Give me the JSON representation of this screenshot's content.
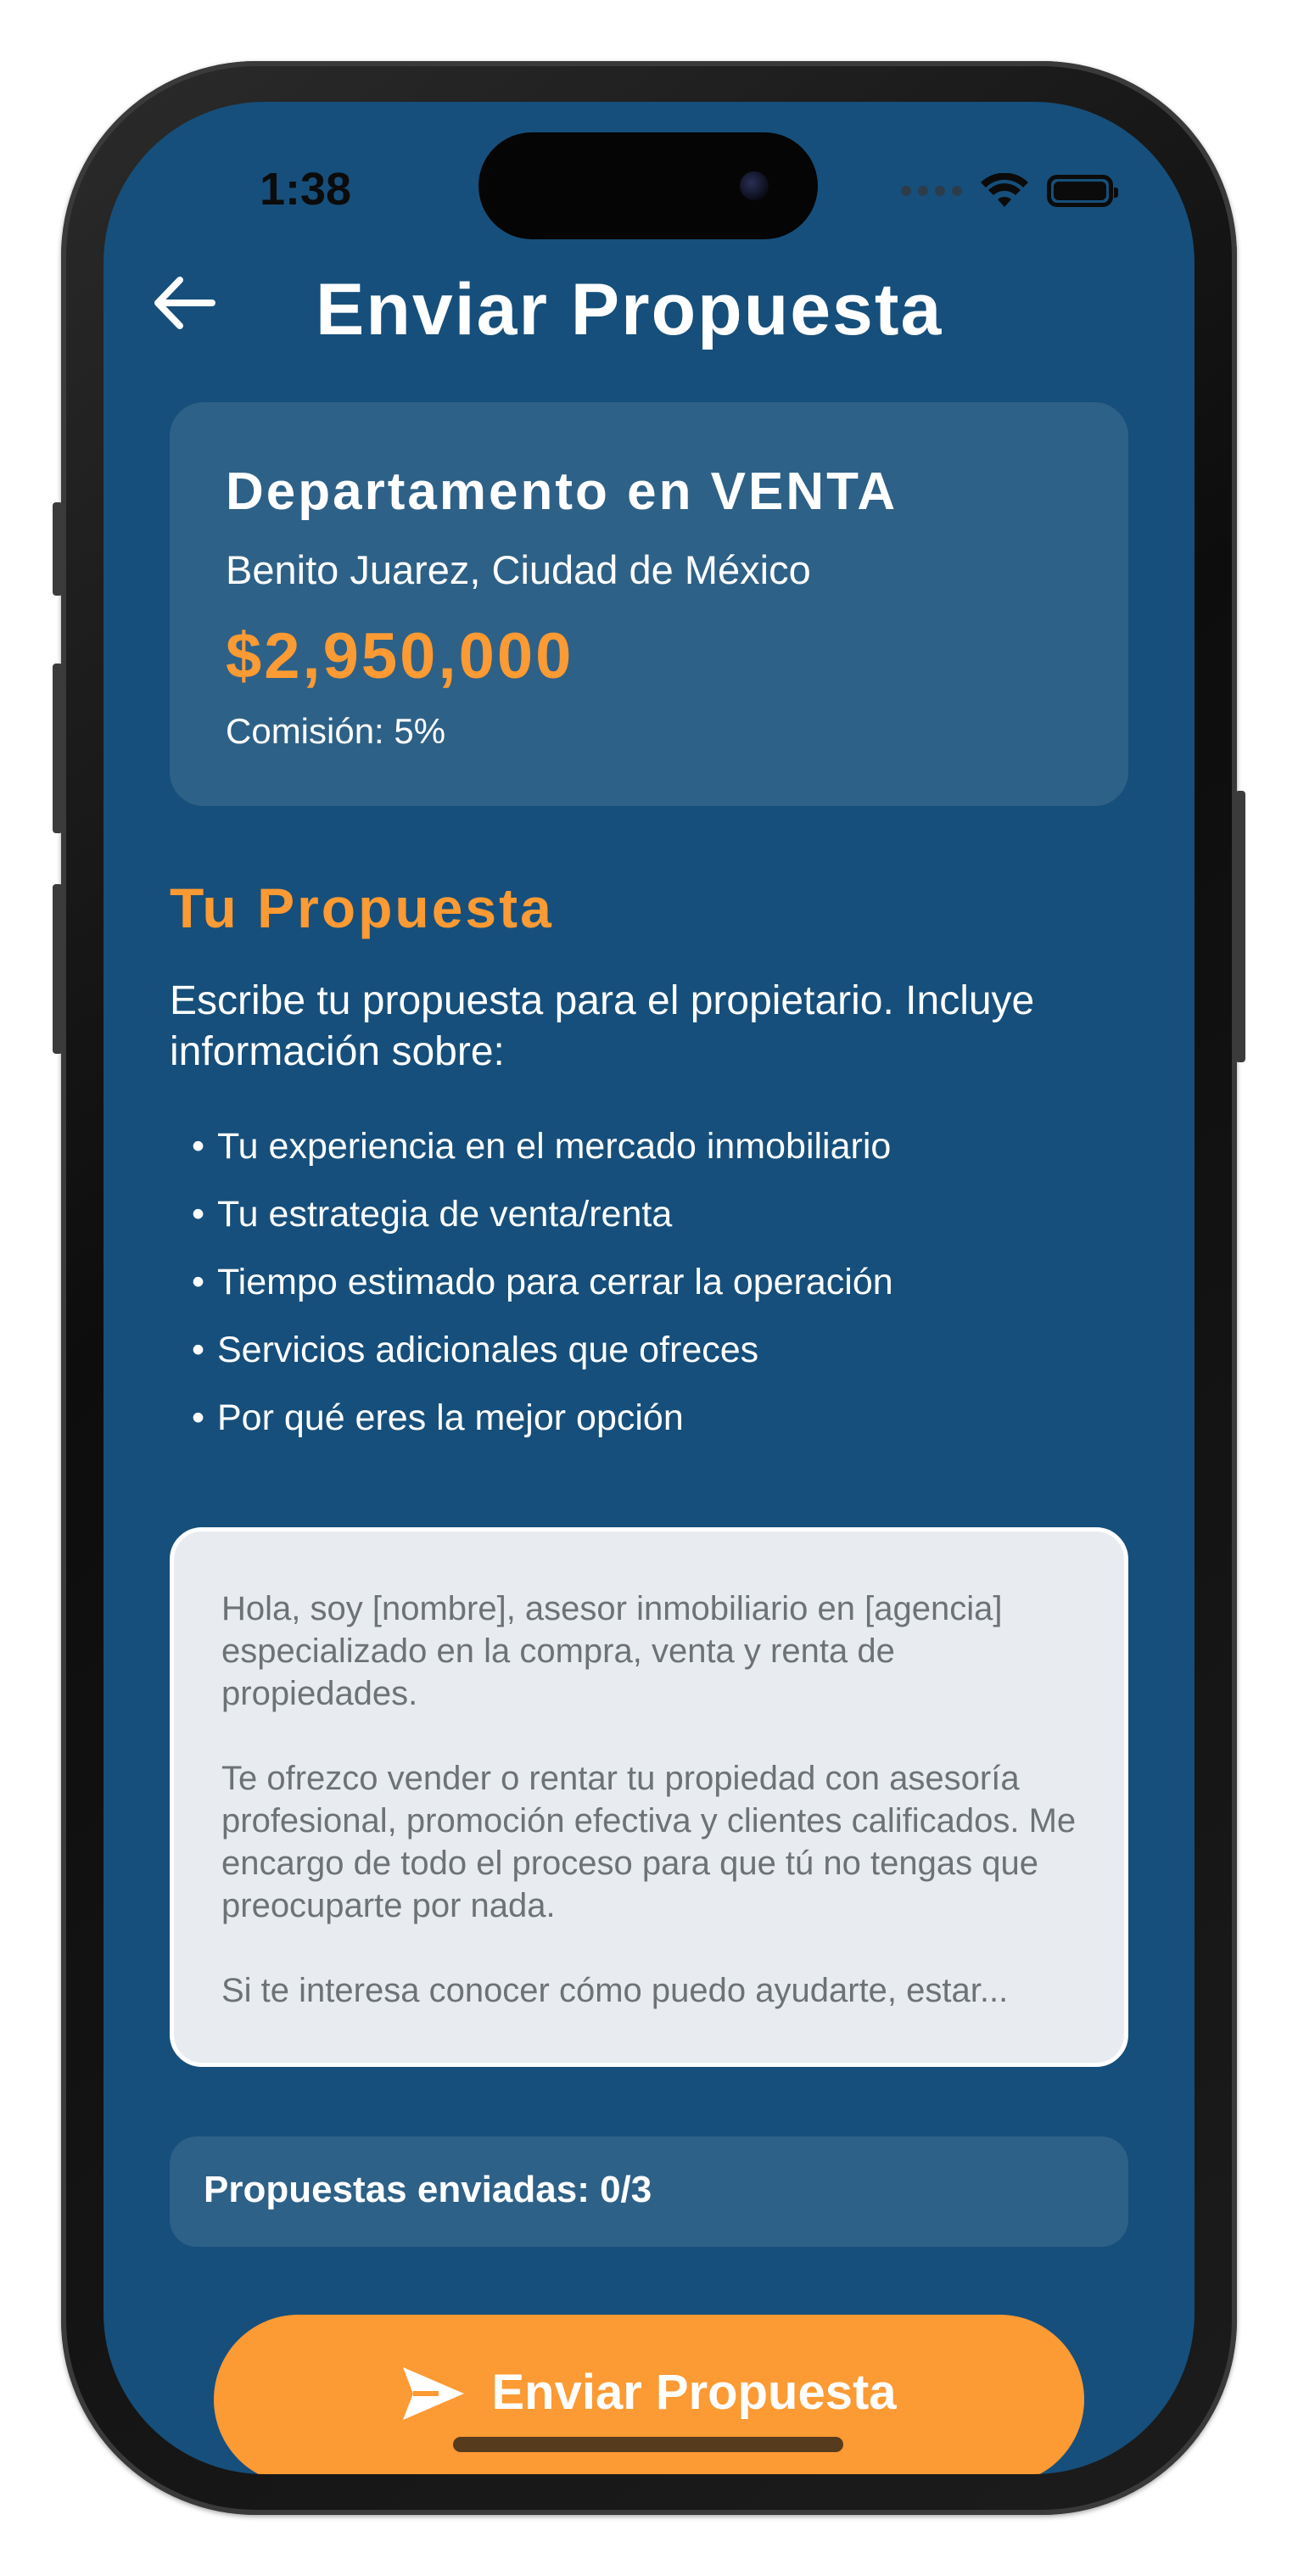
{
  "status_bar": {
    "time": "1:38"
  },
  "header": {
    "title": "Enviar Propuesta",
    "back_icon": "arrow-left-icon"
  },
  "property": {
    "title": "Departamento en VENTA",
    "location": "Benito Juarez, Ciudad de México",
    "price": "$2,950,000",
    "commission": "Comisión: 5%"
  },
  "proposal_section": {
    "title": "Tu Propuesta",
    "intro": "Escribe tu propuesta para el propietario. Incluye información sobre:",
    "bullet_char": "•",
    "bullets": [
      "Tu experiencia en el mercado inmobiliario",
      "Tu estrategia de venta/renta",
      "Tiempo estimado para cerrar la operación",
      "Servicios adicionales que ofreces",
      "Por qué eres la mejor opción"
    ]
  },
  "proposal_input": {
    "paragraphs": [
      "Hola, soy [nombre], asesor inmobiliario en [agencia] especializado en la compra, venta y renta de propiedades.",
      "Te ofrezco vender o rentar tu propiedad con asesoría profesional, promoción efectiva y clientes calificados. Me encargo de todo el proceso para que tú no tengas que preocuparte por nada.",
      "Si te interesa conocer cómo puedo ayudarte, estar..."
    ]
  },
  "counter": {
    "label": "Propuestas enviadas: 0/3"
  },
  "send_button": {
    "label": "Enviar Propuesta",
    "icon": "send-icon"
  },
  "colors": {
    "background": "#164f7b",
    "card": "#2e6187",
    "accent": "#fc9a33",
    "input_bg": "#e8ecf0",
    "input_text": "#6d7276"
  }
}
